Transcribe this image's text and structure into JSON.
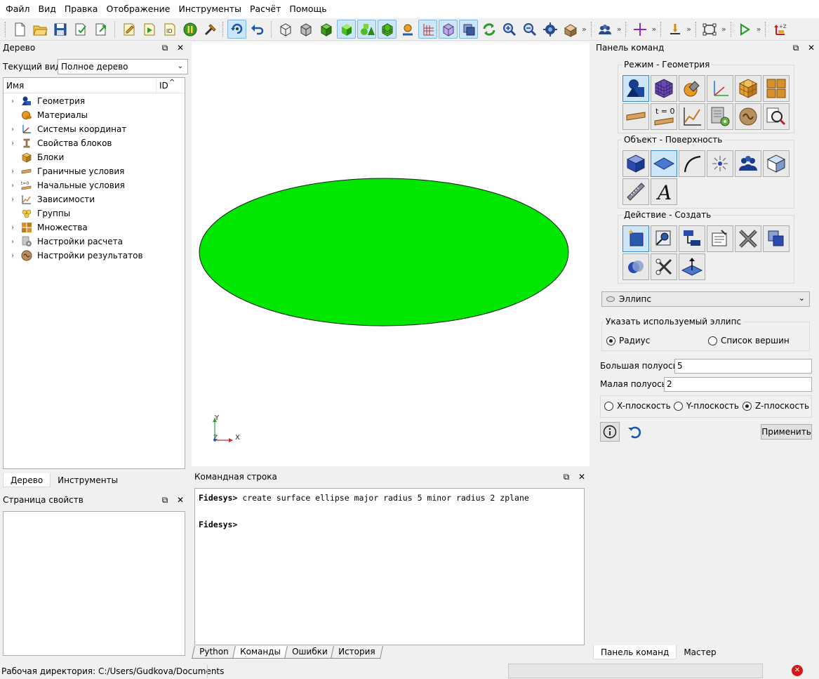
{
  "menu": [
    "Файл",
    "Вид",
    "Правка",
    "Отображение",
    "Инструменты",
    "Расчёт",
    "Помощь"
  ],
  "toolbar": {
    "more": "»",
    "icons": [
      "new-file-icon",
      "open-folder-icon",
      "save-icon",
      "save-as-icon",
      "export-icon",
      "journal-icon",
      "play-script-icon",
      "id-icon",
      "pause-icon",
      "wrench-hammer-icon",
      "rotate-view-icon",
      "undo-icon",
      "wireframe-cube-icon",
      "hidden-line-cube-icon",
      "shaded-cube-icon",
      "solid-green-cube-icon",
      "shapes-icon",
      "mesh-cube-icon",
      "node-icon",
      "axes-grid-icon",
      "transparent-cube-icon",
      "cut-plane-icon",
      "refresh-icon",
      "zoom-in-icon",
      "zoom-out-icon",
      "fit-view-icon",
      "box-icon",
      "group-icon",
      "cross-icon",
      "measure-icon",
      "bounding-box-icon",
      "run-icon",
      "axis-toggle-icon"
    ]
  },
  "tree_panel": {
    "title": "Дерево",
    "current_view_label": "Текущий вид",
    "current_view_value": "Полное дерево",
    "col_name": "Имя",
    "col_id": "ID",
    "items": [
      {
        "label": "Геометрия",
        "expandable": true,
        "icon": "geometry-icon"
      },
      {
        "label": "Материалы",
        "expandable": false,
        "icon": "materials-icon"
      },
      {
        "label": "Системы координат",
        "expandable": true,
        "icon": "coordinate-systems-icon"
      },
      {
        "label": "Свойства блоков",
        "expandable": true,
        "icon": "block-properties-icon"
      },
      {
        "label": "Блоки",
        "expandable": false,
        "icon": "blocks-icon"
      },
      {
        "label": "Граничные условия",
        "expandable": true,
        "icon": "boundary-conditions-icon"
      },
      {
        "label": "Начальные условия",
        "expandable": true,
        "icon": "initial-conditions-icon"
      },
      {
        "label": "Зависимости",
        "expandable": true,
        "icon": "dependencies-icon"
      },
      {
        "label": "Группы",
        "expandable": false,
        "icon": "groups-icon"
      },
      {
        "label": "Множества",
        "expandable": true,
        "icon": "sets-icon"
      },
      {
        "label": "Настройки расчета",
        "expandable": true,
        "icon": "calculation-settings-icon"
      },
      {
        "label": "Настройки результатов",
        "expandable": true,
        "icon": "result-settings-icon"
      }
    ],
    "tabs": [
      "Дерево",
      "Инструменты"
    ]
  },
  "props_panel": {
    "title": "Страница свойств"
  },
  "viewport": {
    "shape_color": "#00e600",
    "axes": {
      "y": "Y",
      "x": "X",
      "z": "Z"
    }
  },
  "command_line": {
    "title": "Командная строка",
    "lines": [
      {
        "prompt": "Fidesys>",
        "text": " create surface ellipse major radius 5 minor radius 2 zplane"
      },
      {
        "prompt": "",
        "text": ""
      },
      {
        "prompt": "Fidesys>",
        "text": ""
      }
    ],
    "tabs": [
      "Python",
      "Команды",
      "Ошибки",
      "История"
    ]
  },
  "command_panel": {
    "title": "Панель команд",
    "mode_label": "Режим - Геометрия",
    "object_label": "Объект - Поверхность",
    "action_label": "Действие - Создать",
    "mode_t0": "t = 0",
    "shape_value": "Эллипс",
    "ellipse_group_label": "Указать используемый эллипс",
    "radio_radius": "Радиус",
    "radio_vertices": "Список вершин",
    "major_label": "Большая полуось",
    "major_value": "5",
    "minor_label": "Малая полуось",
    "minor_value": "2",
    "plane_x": "X-плоскость",
    "plane_y": "Y-плоскость",
    "plane_z": "Z-плоскость",
    "apply_label": "Применить",
    "tabs": [
      "Панель команд",
      "Мастер"
    ]
  },
  "status": {
    "workdir": "Рабочая директория: C:/Users/Gudkova/Documents"
  }
}
